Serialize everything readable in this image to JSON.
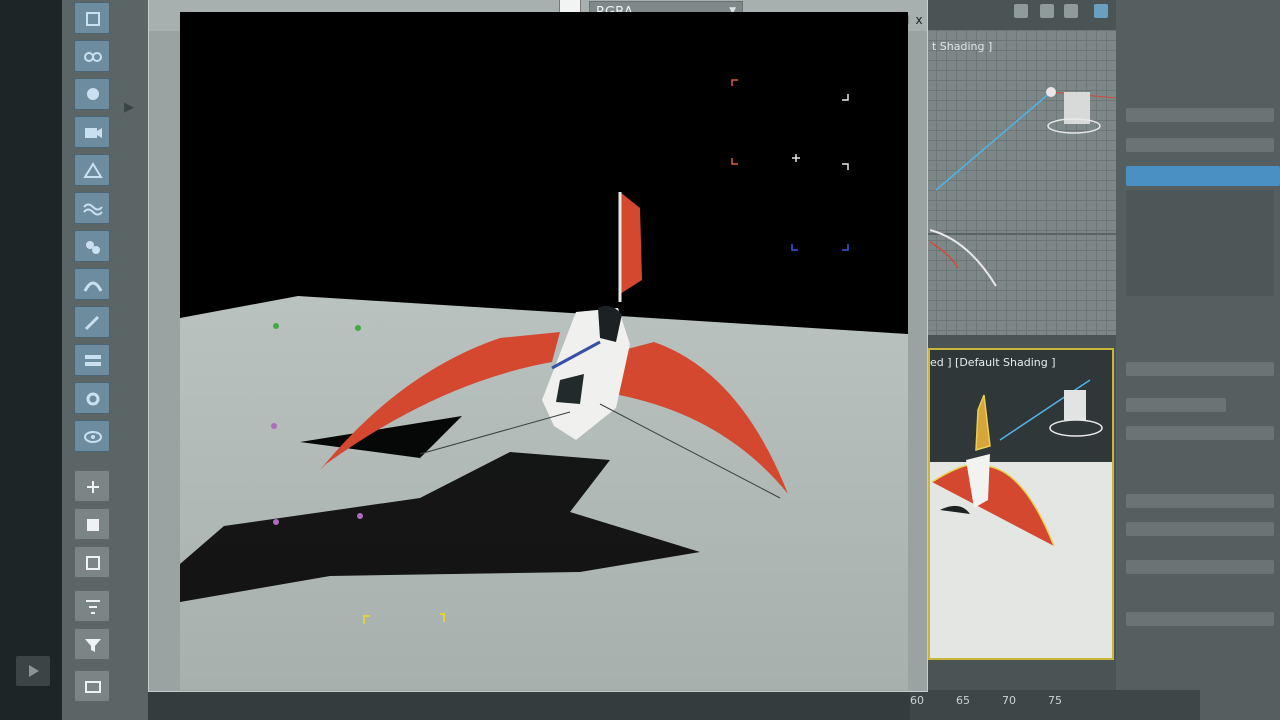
{
  "frame_window": {
    "channel": "RGBA",
    "minimize": "_",
    "restore": "☐",
    "close": "x"
  },
  "viewports": {
    "top_label": "t Shading ]",
    "persp_label": "ed ] [Default Shading ]"
  },
  "timeline": {
    "ticks": [
      "60",
      "65",
      "70",
      "75"
    ]
  },
  "colors": {
    "accent": "#c9b53a",
    "ship_red": "#d4482f",
    "tool_blue": "#6d8c9e"
  }
}
